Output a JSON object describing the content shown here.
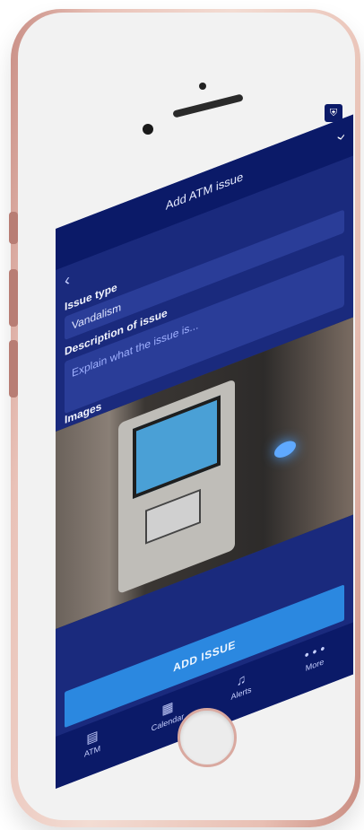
{
  "header": {
    "title": "Add ATM issue"
  },
  "form": {
    "issue_type_label": "Issue type",
    "issue_type_value": "Vandalism",
    "description_label": "Description of issue",
    "description_placeholder": "Explain what the issue is...",
    "images_label": "Images"
  },
  "actions": {
    "add_issue": "ADD ISSUE"
  },
  "tabbar": {
    "items": [
      {
        "label": "ATM",
        "icon": "atm-icon"
      },
      {
        "label": "Calendar",
        "icon": "calendar-icon"
      },
      {
        "label": "Alerts",
        "icon": "bell-icon"
      },
      {
        "label": "More",
        "icon": "more-dots-icon"
      }
    ]
  },
  "colors": {
    "app_bg": "#1a2a7d",
    "bar_bg": "#0b1a68",
    "accent": "#2b88e0",
    "phone_rose": "#e9c2b8"
  }
}
